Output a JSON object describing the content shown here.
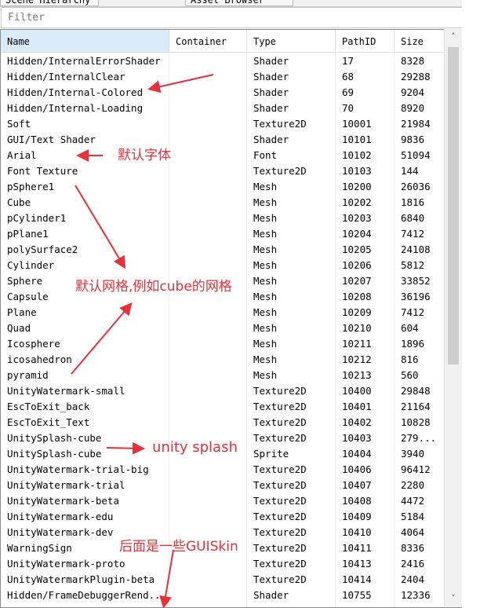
{
  "tabs": [
    {
      "label": "Scene Hierarchy"
    },
    {
      "label": "Asset Browser"
    }
  ],
  "filter": {
    "placeholder": "Filter",
    "value": ""
  },
  "columns": [
    "Name",
    "Container",
    "Type",
    "PathID",
    "Size"
  ],
  "sorted_column": "Name",
  "rows": [
    {
      "name": "Hidden/InternalErrorShader",
      "container": "",
      "type": "Shader",
      "pathid": "17",
      "size": "8328"
    },
    {
      "name": "Hidden/InternalClear",
      "container": "",
      "type": "Shader",
      "pathid": "68",
      "size": "29288"
    },
    {
      "name": "Hidden/Internal-Colored",
      "container": "",
      "type": "Shader",
      "pathid": "69",
      "size": "9204"
    },
    {
      "name": "Hidden/Internal-Loading",
      "container": "",
      "type": "Shader",
      "pathid": "70",
      "size": "8920"
    },
    {
      "name": "Soft",
      "container": "",
      "type": "Texture2D",
      "pathid": "10001",
      "size": "21984"
    },
    {
      "name": "GUI/Text Shader",
      "container": "",
      "type": "Shader",
      "pathid": "10101",
      "size": "9836"
    },
    {
      "name": "Arial",
      "container": "",
      "type": "Font",
      "pathid": "10102",
      "size": "51094"
    },
    {
      "name": "Font Texture",
      "container": "",
      "type": "Texture2D",
      "pathid": "10103",
      "size": "144"
    },
    {
      "name": "pSphere1",
      "container": "",
      "type": "Mesh",
      "pathid": "10200",
      "size": "26036"
    },
    {
      "name": "Cube",
      "container": "",
      "type": "Mesh",
      "pathid": "10202",
      "size": "1816"
    },
    {
      "name": "pCylinder1",
      "container": "",
      "type": "Mesh",
      "pathid": "10203",
      "size": "6840"
    },
    {
      "name": "pPlane1",
      "container": "",
      "type": "Mesh",
      "pathid": "10204",
      "size": "7412"
    },
    {
      "name": "polySurface2",
      "container": "",
      "type": "Mesh",
      "pathid": "10205",
      "size": "24108"
    },
    {
      "name": "Cylinder",
      "container": "",
      "type": "Mesh",
      "pathid": "10206",
      "size": "5812"
    },
    {
      "name": "Sphere",
      "container": "",
      "type": "Mesh",
      "pathid": "10207",
      "size": "33852"
    },
    {
      "name": "Capsule",
      "container": "",
      "type": "Mesh",
      "pathid": "10208",
      "size": "36196"
    },
    {
      "name": "Plane",
      "container": "",
      "type": "Mesh",
      "pathid": "10209",
      "size": "7412"
    },
    {
      "name": "Quad",
      "container": "",
      "type": "Mesh",
      "pathid": "10210",
      "size": "604"
    },
    {
      "name": "Icosphere",
      "container": "",
      "type": "Mesh",
      "pathid": "10211",
      "size": "1896"
    },
    {
      "name": "icosahedron",
      "container": "",
      "type": "Mesh",
      "pathid": "10212",
      "size": "816"
    },
    {
      "name": "pyramid",
      "container": "",
      "type": "Mesh",
      "pathid": "10213",
      "size": "560"
    },
    {
      "name": "UnityWatermark-small",
      "container": "",
      "type": "Texture2D",
      "pathid": "10400",
      "size": "29848"
    },
    {
      "name": "EscToExit_back",
      "container": "",
      "type": "Texture2D",
      "pathid": "10401",
      "size": "21164"
    },
    {
      "name": "EscToExit_Text",
      "container": "",
      "type": "Texture2D",
      "pathid": "10402",
      "size": "10828"
    },
    {
      "name": "UnitySplash-cube",
      "container": "",
      "type": "Texture2D",
      "pathid": "10403",
      "size": "279..."
    },
    {
      "name": "UnitySplash-cube",
      "container": "",
      "type": "Sprite",
      "pathid": "10404",
      "size": "3940"
    },
    {
      "name": "UnityWatermark-trial-big",
      "container": "",
      "type": "Texture2D",
      "pathid": "10406",
      "size": "96412"
    },
    {
      "name": "UnityWatermark-trial",
      "container": "",
      "type": "Texture2D",
      "pathid": "10407",
      "size": "2280"
    },
    {
      "name": "UnityWatermark-beta",
      "container": "",
      "type": "Texture2D",
      "pathid": "10408",
      "size": "4472"
    },
    {
      "name": "UnityWatermark-edu",
      "container": "",
      "type": "Texture2D",
      "pathid": "10409",
      "size": "5184"
    },
    {
      "name": "UnityWatermark-dev",
      "container": "",
      "type": "Texture2D",
      "pathid": "10410",
      "size": "4064"
    },
    {
      "name": "WarningSign",
      "container": "",
      "type": "Texture2D",
      "pathid": "10411",
      "size": "8336"
    },
    {
      "name": "UnityWatermark-proto",
      "container": "",
      "type": "Texture2D",
      "pathid": "10413",
      "size": "2416"
    },
    {
      "name": "UnityWatermarkPlugin-beta",
      "container": "",
      "type": "Texture2D",
      "pathid": "10414",
      "size": "2404"
    },
    {
      "name": "Hidden/FrameDebuggerRend...",
      "container": "",
      "type": "Shader",
      "pathid": "10755",
      "size": "12336"
    }
  ],
  "annotations": {
    "default_font": "默认字体",
    "default_mesh": "默认网格,例如cube的网格",
    "unity_splash": "unity splash",
    "guiskin": "后面是一些GUISkin"
  },
  "colors": {
    "annotation": "#e8303a",
    "header_sorted": "#d9ebf9",
    "scroll_thumb": "#cdcdcd"
  },
  "icons": {
    "scroll_up": "chevron-up-icon",
    "scroll_down": "chevron-down-icon"
  }
}
